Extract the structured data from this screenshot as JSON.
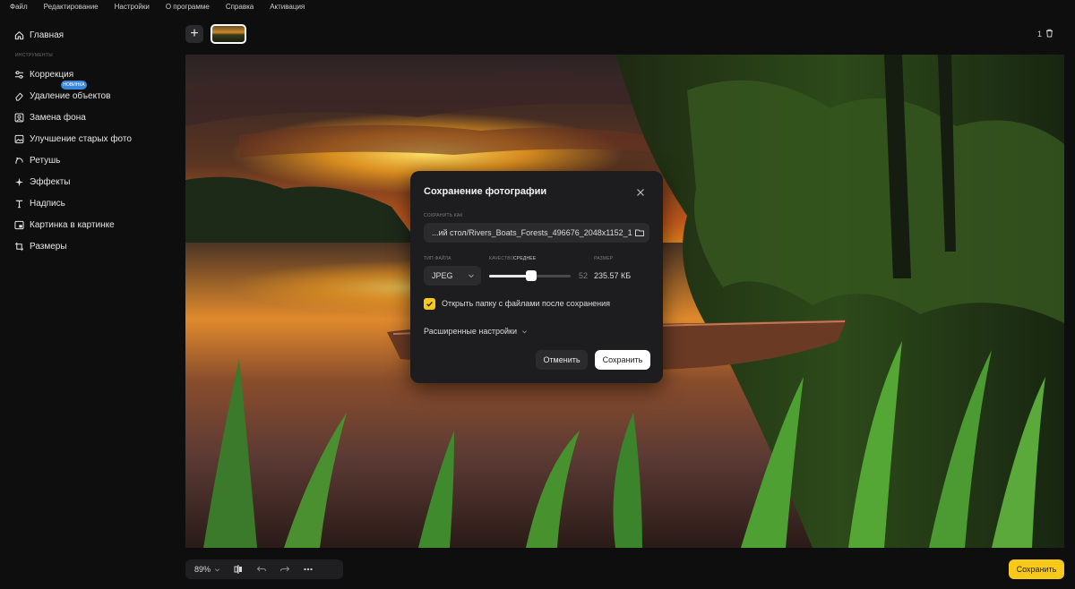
{
  "menu": [
    "Файл",
    "Редактирование",
    "Настройки",
    "О программе",
    "Справка",
    "Активация"
  ],
  "sidebar": {
    "home": "Главная",
    "section_label": "ИНСТРУМЕНТЫ",
    "badge": "НОВИНКА",
    "items": [
      {
        "label": "Коррекция",
        "icon": "sliders-icon"
      },
      {
        "label": "Удаление объектов",
        "icon": "eraser-icon"
      },
      {
        "label": "Замена фона",
        "icon": "portrait-icon"
      },
      {
        "label": "Улучшение старых фото",
        "icon": "photo-restore-icon"
      },
      {
        "label": "Ретушь",
        "icon": "retouch-icon"
      },
      {
        "label": "Эффекты",
        "icon": "sparkle-icon"
      },
      {
        "label": "Надпись",
        "icon": "text-icon"
      },
      {
        "label": "Картинка в картинке",
        "icon": "picture-in-picture-icon"
      },
      {
        "label": "Размеры",
        "icon": "crop-icon"
      }
    ]
  },
  "top": {
    "add_label": "+",
    "photo_count": "1"
  },
  "bottom": {
    "zoom": "89%",
    "save_label": "Сохранить"
  },
  "dialog": {
    "title": "Сохранение фотографии",
    "save_as_label": "СОХРАНИТЬ КАК",
    "path_value": "...ий стол/Rivers_Boats_Forests_496676_2048x1152_1",
    "filetype_label": "ТИП ФАЙЛА",
    "quality_label": "КАЧЕСТВО",
    "quality_level": "СРЕДНЕЕ",
    "size_label": "РАЗМЕР",
    "filetype_value": "JPEG",
    "quality_value": "52",
    "quality_fraction": 0.52,
    "size_value": "235.57 КБ",
    "open_folder_label": "Открыть папку с файлами после сохранения",
    "open_folder_checked": true,
    "advanced_label": "Расширенные настройки",
    "cancel_label": "Отменить",
    "save_label": "Сохранить"
  },
  "colors": {
    "accent_yellow": "#f6c91a",
    "badge_blue": "#3b86d8",
    "dialog_bg": "#1d1d1f",
    "app_bg": "#0e0e0f"
  }
}
